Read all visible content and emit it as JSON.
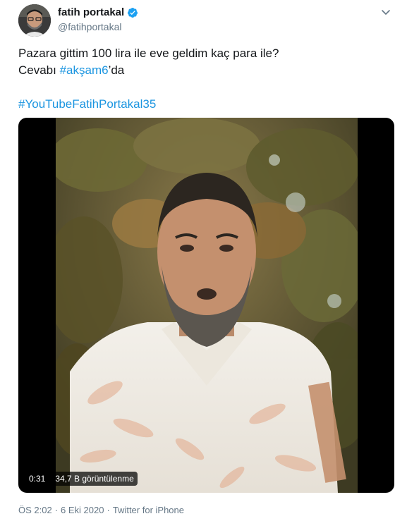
{
  "author": {
    "display_name": "fatih portakal",
    "handle": "@fatihportakal",
    "verified": true
  },
  "tweet": {
    "line1": "Pazara gittim 100 lira ile eve geldim kaç para ile?",
    "line2_prefix": "Cevabı ",
    "line2_hashtag": "#akşam6",
    "line2_suffix": "’da",
    "hashtag2": "#YouTubeFatihPortakal35"
  },
  "video": {
    "duration": "0:31",
    "views": "34,7 B görüntülenme"
  },
  "footer": {
    "time": "ÖS 2:02",
    "separator": "·",
    "date": "6 Eki 2020",
    "separator2": "·",
    "source": "Twitter for iPhone"
  },
  "colors": {
    "link": "#1b95e0",
    "secondary_text": "#657786",
    "verified": "#1da1f2"
  },
  "icons": {
    "verified": "verified-badge-icon",
    "caret": "chevron-down-icon"
  }
}
